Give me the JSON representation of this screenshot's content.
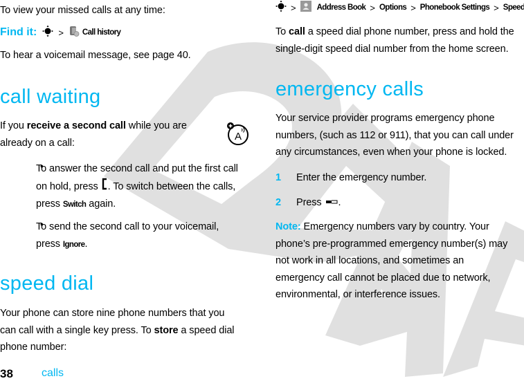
{
  "watermark": "DRAFT",
  "left": {
    "intro": "To view your missed calls at any time:",
    "find_it": {
      "label": "Find it:",
      "separator": ">",
      "nav_icon": "nav-key-icon",
      "item_icon": "call-history-icon",
      "item": "Call history"
    },
    "voicemail_text": "To hear a voicemail message, see page 40.",
    "call_waiting": {
      "heading": "call waiting",
      "intro_pre": "If you ",
      "intro_bold": "receive a second call",
      "intro_post_line1": " while you are",
      "intro_line2": "already on a call:",
      "feature_icon": "network-feature-icon",
      "bullets": [
        {
          "line1": "To answer the second call and put the first call",
          "line2_pre": "on hold, press ",
          "line2_key": "left-soft-key-icon",
          "line2_post": ". To switch between the calls,",
          "line3_pre": "press ",
          "line3_menu": "Switch",
          "line3_post": " again."
        },
        {
          "line1": "To send the second call to your voicemail,",
          "line2_pre": "press ",
          "line2_menu": "Ignore",
          "line2_post": "."
        }
      ]
    },
    "speed_dial": {
      "heading": "speed dial",
      "line1": "Your phone can store nine phone numbers that you",
      "line2_pre": "can call with a single key press. To ",
      "line2_bold": "store",
      "line2_post": " a speed dial",
      "line3": "phone number:"
    }
  },
  "right": {
    "path": {
      "nav_icon": "nav-key-icon",
      "book_icon": "address-book-icon",
      "sep": ">",
      "items": [
        "Address Book",
        "Options",
        "Phonebook Settings",
        "Speed Dial"
      ]
    },
    "call_text": {
      "pre": "To ",
      "bold": "call",
      "post_line1": " a speed dial phone number, press and hold the",
      "line2": "single-digit speed dial number from the home screen."
    },
    "emergency": {
      "heading": "emergency calls",
      "para_lines": [
        "Your service provider programs emergency phone",
        "numbers, (such as 112 or 911), that you can call under",
        "any circumstances, even when your phone is locked."
      ],
      "steps": [
        {
          "num": "1",
          "text": "Enter the emergency number."
        },
        {
          "num": "2",
          "text_pre": "Press ",
          "key": "send-key-icon",
          "text_post": "."
        }
      ],
      "note_label": "Note:",
      "note_lines": [
        " Emergency numbers vary by country. Your",
        "phone’s pre-programmed emergency number(s) may",
        "not work in all locations, and sometimes an",
        "emergency call cannot be placed due to network,",
        "environmental, or interference issues."
      ]
    }
  },
  "footer": {
    "page_number": "38",
    "section": "calls"
  }
}
